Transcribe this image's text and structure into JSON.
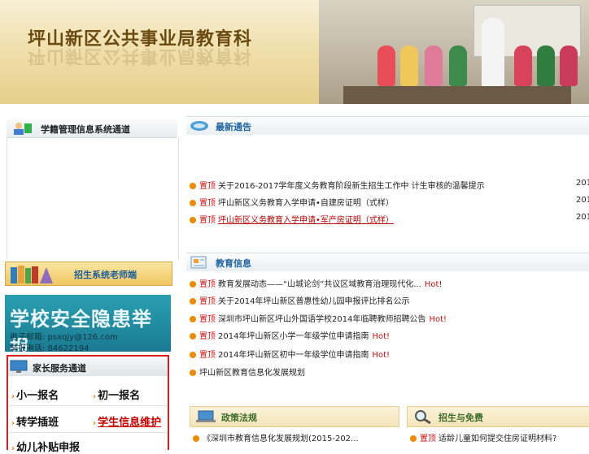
{
  "banner": {
    "title": "坪山新区公共事业局教育科"
  },
  "left": {
    "student_system": {
      "title": "学籍管理信息系统通道"
    },
    "teacher_button": {
      "label": "招生系统老师端"
    },
    "safety": {
      "headline": "学校安全隐患举报",
      "email": "电子邮箱: psxqjy@126.com",
      "phone": "举报电话: 84622194"
    },
    "parent": {
      "title": "家长服务通道",
      "items": [
        "小一报名",
        "初一报名",
        "转学插班",
        "学生信息维护",
        "幼儿补贴申报"
      ]
    }
  },
  "notices": {
    "title": "最新通告",
    "items": [
      {
        "tag": "置顶",
        "text": "关于2016-2017学年度义务教育阶段新生招生工作中 计生审核的温馨提示",
        "date": "201"
      },
      {
        "tag": "置顶",
        "text": "坪山新区义务教育入学申请•自建房证明（式样）",
        "date": "201"
      },
      {
        "tag": "置顶",
        "text": "坪山新区义务教育入学申请•军产房证明（式样）",
        "date": "201"
      }
    ]
  },
  "edu_info": {
    "title": "教育信息",
    "items": [
      {
        "tag": "置顶",
        "text": "教育发展动态——“山城论剑”共议区域教育治理现代化...",
        "hot": "Hot!"
      },
      {
        "tag": "置顶",
        "text": "关于2014年坪山新区普惠性幼儿园申报评比排名公示",
        "hot": ""
      },
      {
        "tag": "置顶",
        "text": "深圳市坪山新区坪山外国语学校2014年临聘教师招聘公告",
        "hot": "Hot!"
      },
      {
        "tag": "置顶",
        "text": "2014年坪山新区小学一年级学位申请指南",
        "hot": "Hot!"
      },
      {
        "tag": "置顶",
        "text": "2014年坪山新区初中一年级学位申请指南",
        "hot": "Hot!"
      },
      {
        "tag": "",
        "text": "坪山新区教育信息化发展规划",
        "hot": ""
      }
    ]
  },
  "policy": {
    "title": "政策法规",
    "item": "《深圳市教育信息化发展规划(2015-202..."
  },
  "admission": {
    "title": "招生与免费",
    "tag": "置顶",
    "item": "适龄儿童如何提交住房证明材料?"
  }
}
